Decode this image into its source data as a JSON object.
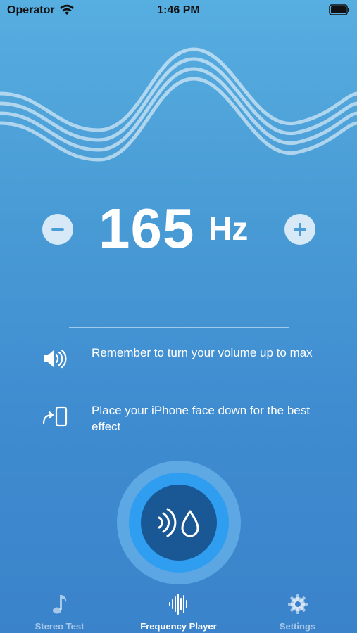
{
  "status_bar": {
    "carrier": "Operator",
    "time": "1:46 PM"
  },
  "frequency": {
    "value": "165",
    "unit": "Hz",
    "decrease_icon": "minus-icon",
    "increase_icon": "plus-icon"
  },
  "tips": [
    {
      "icon": "speaker-volume-icon",
      "text": "Remember to turn your volume up to max"
    },
    {
      "icon": "phone-face-down-icon",
      "text": "Place your iPhone face down for the best effect"
    }
  ],
  "play_button": {
    "icons": [
      "sound-waves-icon",
      "water-drop-icon"
    ]
  },
  "tab_bar": {
    "tabs": [
      {
        "label": "Stereo Test",
        "icon": "music-note-icon",
        "active": false
      },
      {
        "label": "Frequency Player",
        "icon": "waveform-icon",
        "active": true
      },
      {
        "label": "Settings",
        "icon": "gear-icon",
        "active": false
      }
    ]
  },
  "colors": {
    "background_top": "#57aee0",
    "background_bottom": "#3a83cb",
    "play_inner": "#1a5895",
    "play_ring": "#2f9df0"
  }
}
